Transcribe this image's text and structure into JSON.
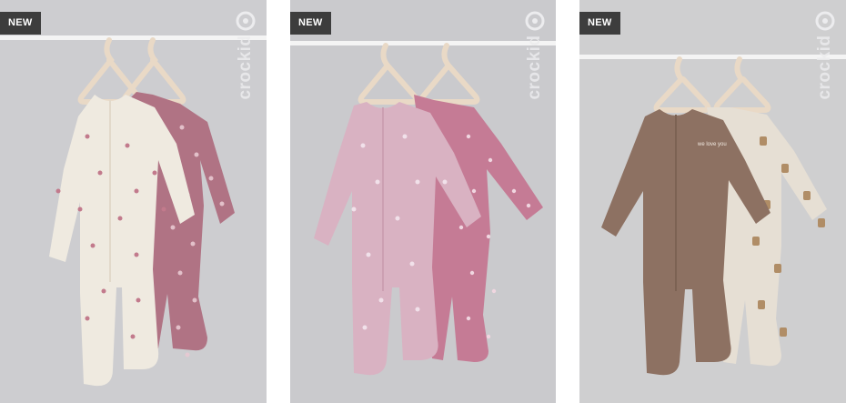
{
  "products": [
    {
      "badge": "NEW",
      "brand": "crockid",
      "image_icon": "sleepsuit-photo",
      "colors": {
        "bg": "#c9c9cc",
        "front": "#efeae0",
        "back": "#b07384",
        "print_front": "#c27a8c",
        "print_back": "#e8c9d1"
      }
    },
    {
      "badge": "NEW",
      "brand": "crockid",
      "image_icon": "sleepsuit-photo",
      "colors": {
        "bg": "#c6c6c9",
        "front": "#d9b2c2",
        "back": "#c57b95",
        "print_front": "#f1e1ea",
        "print_back": "#f0d6e0"
      }
    },
    {
      "badge": "NEW",
      "brand": "crockid",
      "image_icon": "sleepsuit-photo",
      "colors": {
        "bg": "#cbcbcd",
        "front": "#8d7162",
        "back": "#e6dfd4",
        "print_front": "#f0e8df",
        "print_back": "#b08d66"
      },
      "chest_print": "we love you"
    }
  ]
}
